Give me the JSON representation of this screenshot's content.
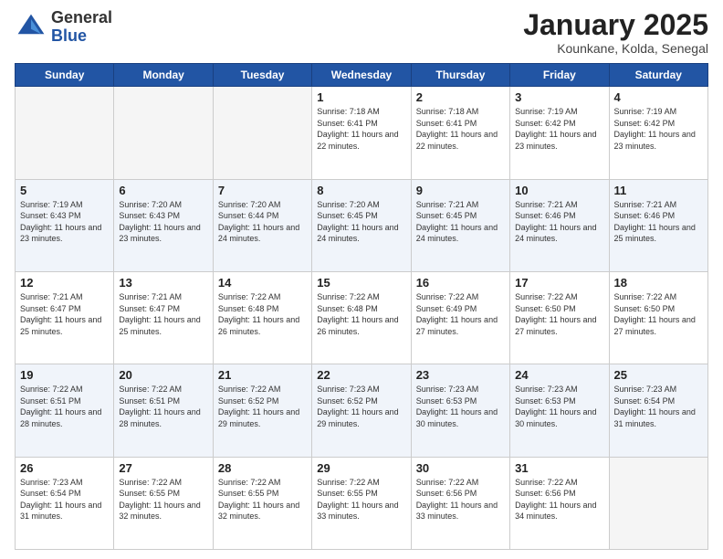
{
  "logo": {
    "general": "General",
    "blue": "Blue"
  },
  "header": {
    "month": "January 2025",
    "location": "Kounkane, Kolda, Senegal"
  },
  "days_of_week": [
    "Sunday",
    "Monday",
    "Tuesday",
    "Wednesday",
    "Thursday",
    "Friday",
    "Saturday"
  ],
  "weeks": [
    [
      {
        "day": "",
        "empty": true
      },
      {
        "day": "",
        "empty": true
      },
      {
        "day": "",
        "empty": true
      },
      {
        "day": "1",
        "sunrise": "7:18 AM",
        "sunset": "6:41 PM",
        "daylight": "11 hours and 22 minutes."
      },
      {
        "day": "2",
        "sunrise": "7:18 AM",
        "sunset": "6:41 PM",
        "daylight": "11 hours and 22 minutes."
      },
      {
        "day": "3",
        "sunrise": "7:19 AM",
        "sunset": "6:42 PM",
        "daylight": "11 hours and 23 minutes."
      },
      {
        "day": "4",
        "sunrise": "7:19 AM",
        "sunset": "6:42 PM",
        "daylight": "11 hours and 23 minutes."
      }
    ],
    [
      {
        "day": "5",
        "sunrise": "7:19 AM",
        "sunset": "6:43 PM",
        "daylight": "11 hours and 23 minutes."
      },
      {
        "day": "6",
        "sunrise": "7:20 AM",
        "sunset": "6:43 PM",
        "daylight": "11 hours and 23 minutes."
      },
      {
        "day": "7",
        "sunrise": "7:20 AM",
        "sunset": "6:44 PM",
        "daylight": "11 hours and 24 minutes."
      },
      {
        "day": "8",
        "sunrise": "7:20 AM",
        "sunset": "6:45 PM",
        "daylight": "11 hours and 24 minutes."
      },
      {
        "day": "9",
        "sunrise": "7:21 AM",
        "sunset": "6:45 PM",
        "daylight": "11 hours and 24 minutes."
      },
      {
        "day": "10",
        "sunrise": "7:21 AM",
        "sunset": "6:46 PM",
        "daylight": "11 hours and 24 minutes."
      },
      {
        "day": "11",
        "sunrise": "7:21 AM",
        "sunset": "6:46 PM",
        "daylight": "11 hours and 25 minutes."
      }
    ],
    [
      {
        "day": "12",
        "sunrise": "7:21 AM",
        "sunset": "6:47 PM",
        "daylight": "11 hours and 25 minutes."
      },
      {
        "day": "13",
        "sunrise": "7:21 AM",
        "sunset": "6:47 PM",
        "daylight": "11 hours and 25 minutes."
      },
      {
        "day": "14",
        "sunrise": "7:22 AM",
        "sunset": "6:48 PM",
        "daylight": "11 hours and 26 minutes."
      },
      {
        "day": "15",
        "sunrise": "7:22 AM",
        "sunset": "6:48 PM",
        "daylight": "11 hours and 26 minutes."
      },
      {
        "day": "16",
        "sunrise": "7:22 AM",
        "sunset": "6:49 PM",
        "daylight": "11 hours and 27 minutes."
      },
      {
        "day": "17",
        "sunrise": "7:22 AM",
        "sunset": "6:50 PM",
        "daylight": "11 hours and 27 minutes."
      },
      {
        "day": "18",
        "sunrise": "7:22 AM",
        "sunset": "6:50 PM",
        "daylight": "11 hours and 27 minutes."
      }
    ],
    [
      {
        "day": "19",
        "sunrise": "7:22 AM",
        "sunset": "6:51 PM",
        "daylight": "11 hours and 28 minutes."
      },
      {
        "day": "20",
        "sunrise": "7:22 AM",
        "sunset": "6:51 PM",
        "daylight": "11 hours and 28 minutes."
      },
      {
        "day": "21",
        "sunrise": "7:22 AM",
        "sunset": "6:52 PM",
        "daylight": "11 hours and 29 minutes."
      },
      {
        "day": "22",
        "sunrise": "7:23 AM",
        "sunset": "6:52 PM",
        "daylight": "11 hours and 29 minutes."
      },
      {
        "day": "23",
        "sunrise": "7:23 AM",
        "sunset": "6:53 PM",
        "daylight": "11 hours and 30 minutes."
      },
      {
        "day": "24",
        "sunrise": "7:23 AM",
        "sunset": "6:53 PM",
        "daylight": "11 hours and 30 minutes."
      },
      {
        "day": "25",
        "sunrise": "7:23 AM",
        "sunset": "6:54 PM",
        "daylight": "11 hours and 31 minutes."
      }
    ],
    [
      {
        "day": "26",
        "sunrise": "7:23 AM",
        "sunset": "6:54 PM",
        "daylight": "11 hours and 31 minutes."
      },
      {
        "day": "27",
        "sunrise": "7:22 AM",
        "sunset": "6:55 PM",
        "daylight": "11 hours and 32 minutes."
      },
      {
        "day": "28",
        "sunrise": "7:22 AM",
        "sunset": "6:55 PM",
        "daylight": "11 hours and 32 minutes."
      },
      {
        "day": "29",
        "sunrise": "7:22 AM",
        "sunset": "6:55 PM",
        "daylight": "11 hours and 33 minutes."
      },
      {
        "day": "30",
        "sunrise": "7:22 AM",
        "sunset": "6:56 PM",
        "daylight": "11 hours and 33 minutes."
      },
      {
        "day": "31",
        "sunrise": "7:22 AM",
        "sunset": "6:56 PM",
        "daylight": "11 hours and 34 minutes."
      },
      {
        "day": "",
        "empty": true
      }
    ]
  ]
}
